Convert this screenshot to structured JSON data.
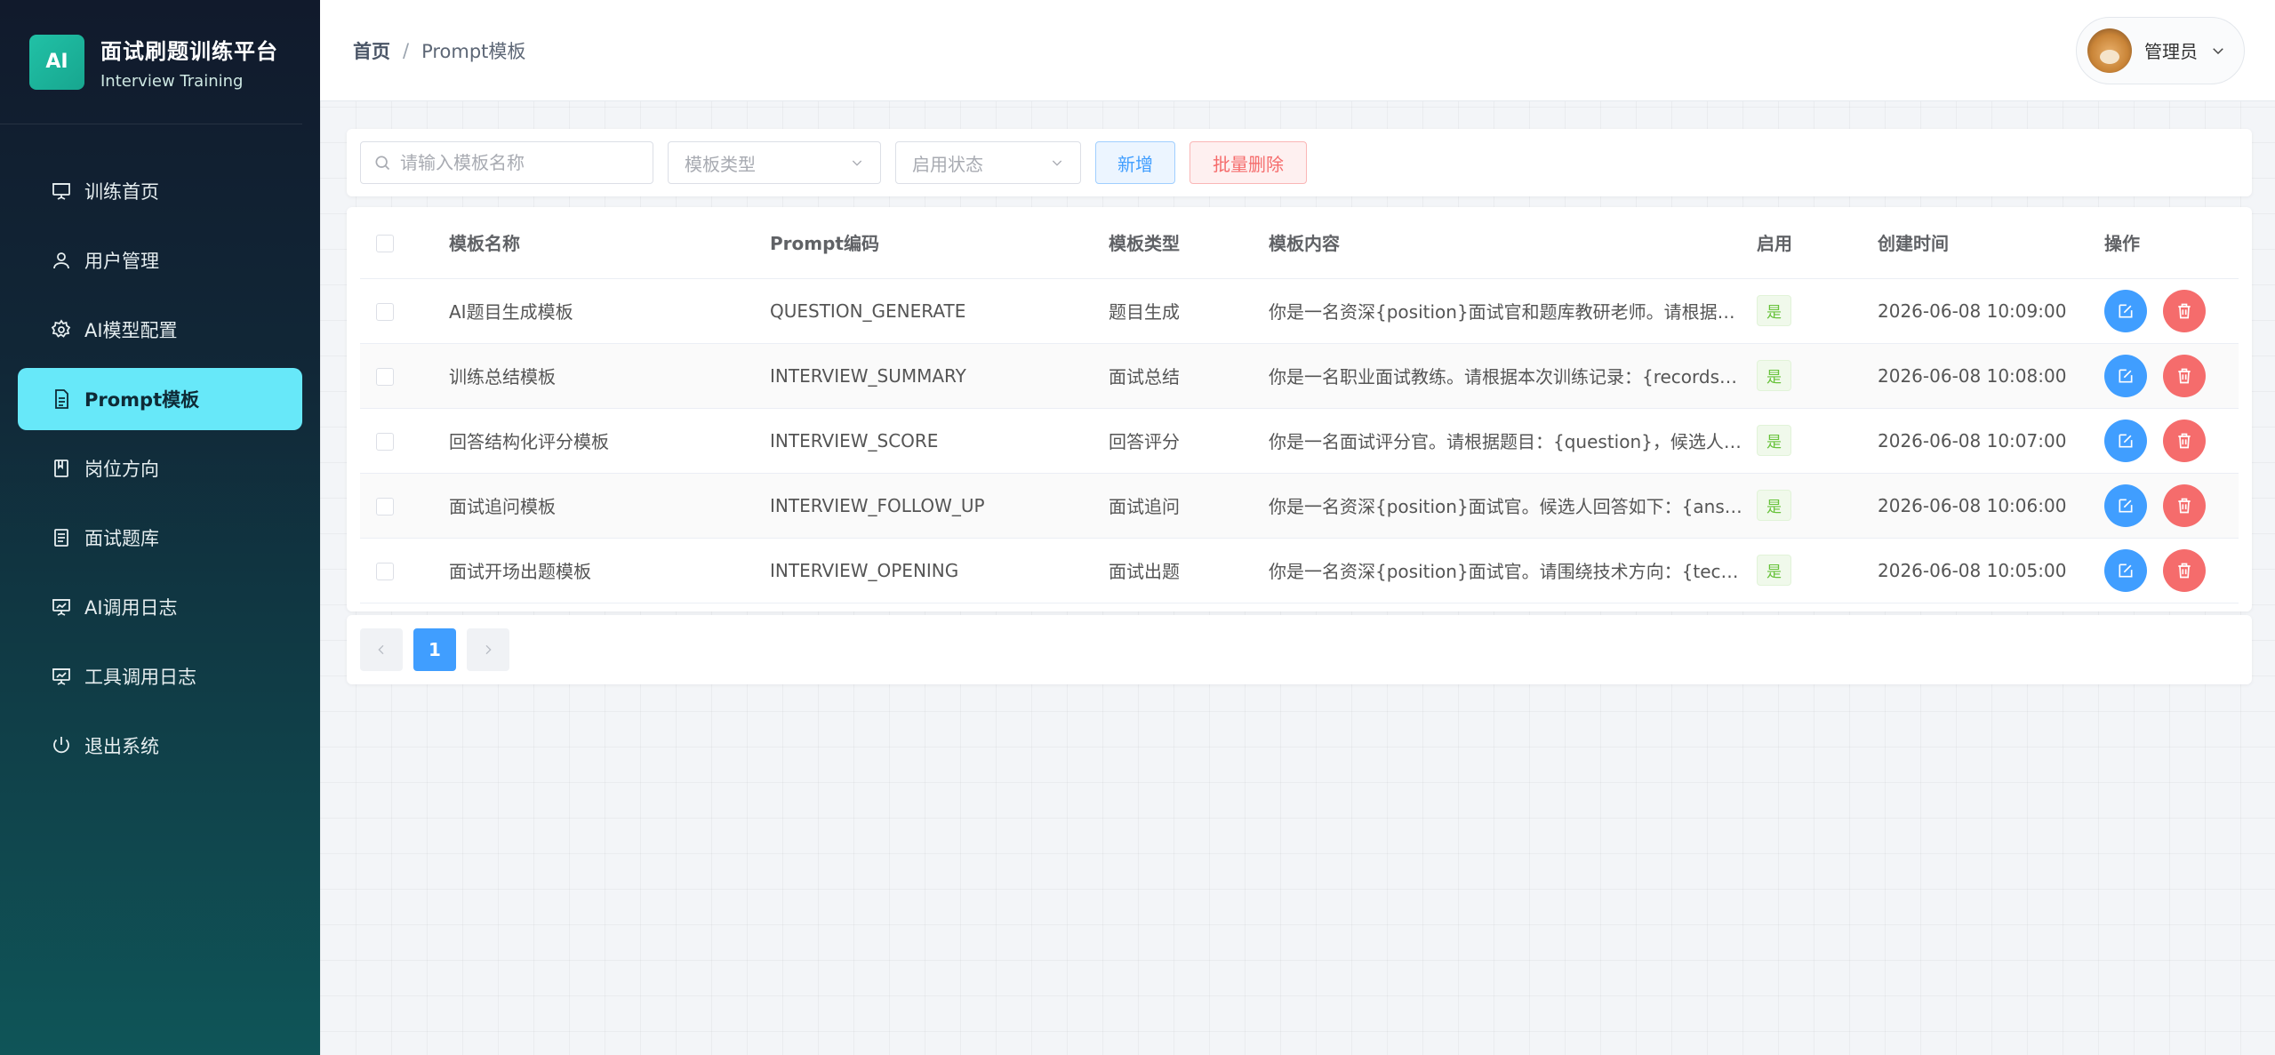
{
  "brand": {
    "logo": "AI",
    "title": "面试刷题训练平台",
    "subtitle": "Interview Training"
  },
  "sidebar": {
    "items": [
      {
        "label": "训练首页",
        "icon": "presentation-icon",
        "active": false
      },
      {
        "label": "用户管理",
        "icon": "user-icon",
        "active": false
      },
      {
        "label": "AI模型配置",
        "icon": "gear-icon",
        "active": false
      },
      {
        "label": "Prompt模板",
        "icon": "document-icon",
        "active": true
      },
      {
        "label": "岗位方向",
        "icon": "book-icon",
        "active": false
      },
      {
        "label": "面试题库",
        "icon": "list-document-icon",
        "active": false
      },
      {
        "label": "AI调用日志",
        "icon": "chart-board-icon",
        "active": false
      },
      {
        "label": "工具调用日志",
        "icon": "chart-board-icon",
        "active": false
      },
      {
        "label": "退出系统",
        "icon": "power-icon",
        "active": false
      }
    ]
  },
  "header": {
    "breadcrumb_home": "首页",
    "breadcrumb_sep": "/",
    "breadcrumb_current": "Prompt模板",
    "user_name": "管理员"
  },
  "toolbar": {
    "search_placeholder": "请输入模板名称",
    "type_placeholder": "模板类型",
    "status_placeholder": "启用状态",
    "add_label": "新增",
    "batch_delete_label": "批量删除"
  },
  "table": {
    "columns": [
      "模板名称",
      "Prompt编码",
      "模板类型",
      "模板内容",
      "启用",
      "创建时间",
      "操作"
    ],
    "rows": [
      {
        "name": "AI题目生成模板",
        "code": "QUESTION_GENERATE",
        "type": "题目生成",
        "content": "你是一名资深{position}面试官和题库教研老师。请根据…",
        "enabled": "是",
        "created": "2026-06-08 10:09:00"
      },
      {
        "name": "训练总结模板",
        "code": "INTERVIEW_SUMMARY",
        "type": "面试总结",
        "content": "你是一名职业面试教练。请根据本次训练记录：{records}…",
        "enabled": "是",
        "created": "2026-06-08 10:08:00"
      },
      {
        "name": "回答结构化评分模板",
        "code": "INTERVIEW_SCORE",
        "type": "回答评分",
        "content": "你是一名面试评分官。请根据题目：{question}，候选人…",
        "enabled": "是",
        "created": "2026-06-08 10:07:00"
      },
      {
        "name": "面试追问模板",
        "code": "INTERVIEW_FOLLOW_UP",
        "type": "面试追问",
        "content": "你是一名资深{position}面试官。候选人回答如下：{answer}…",
        "enabled": "是",
        "created": "2026-06-08 10:06:00"
      },
      {
        "name": "面试开场出题模板",
        "code": "INTERVIEW_OPENING",
        "type": "面试出题",
        "content": "你是一名资深{position}面试官。请围绕技术方向：{tech}…",
        "enabled": "是",
        "created": "2026-06-08 10:05:00"
      }
    ]
  },
  "pagination": {
    "current": "1"
  },
  "colors": {
    "primary": "#409eff",
    "danger": "#f56c6c",
    "active_menu": "#67e8f9",
    "brand": "#21c1a6"
  }
}
